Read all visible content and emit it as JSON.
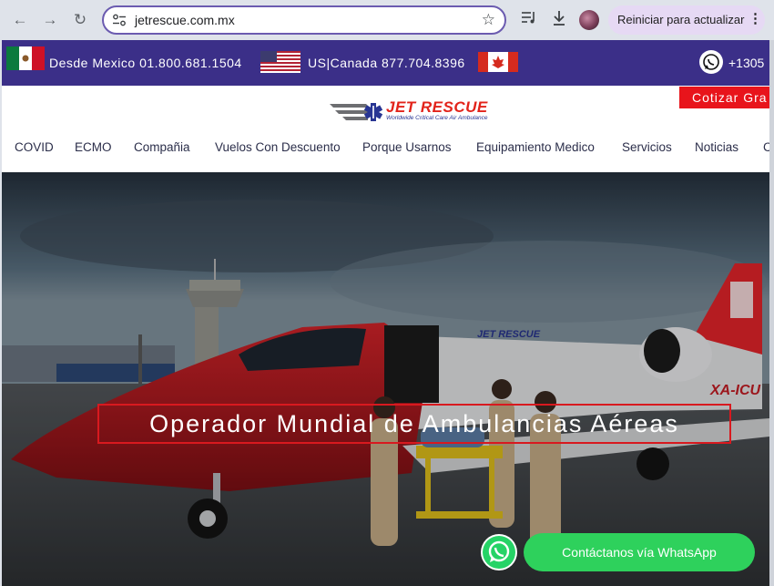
{
  "browser": {
    "url": "jetrescue.com.mx",
    "update_label": "Reiniciar para actualizar"
  },
  "topbar": {
    "mexico_phone": "Desde Mexico 01.800.681.1504",
    "us_canada_phone": "US|Canada 877.704.8396",
    "whatsapp_phone": "+1305"
  },
  "header": {
    "logo_brand": "JET RESCUE",
    "logo_tagline": "Worldwide Critical Care Air Ambulance",
    "cta_label": "Cotizar Gra",
    "menu": [
      "COVID",
      "ECMO",
      "Compañia",
      "Vuelos Con Descuento",
      "Porque Usarnos",
      "Equipamiento Medico",
      "Servicios",
      "Noticias",
      "C"
    ]
  },
  "hero": {
    "title": "Operador Mundial de Ambulancias Aéreas",
    "plane_registration": "XA-ICU",
    "fuselage_text": "JET RESCUE"
  },
  "whatsapp_button": {
    "label": "Contáctanos vía WhatsApp"
  },
  "colors": {
    "topbar_bg": "#3b2f88",
    "accent_red": "#e8141b",
    "whatsapp_green": "#2ed15c"
  }
}
